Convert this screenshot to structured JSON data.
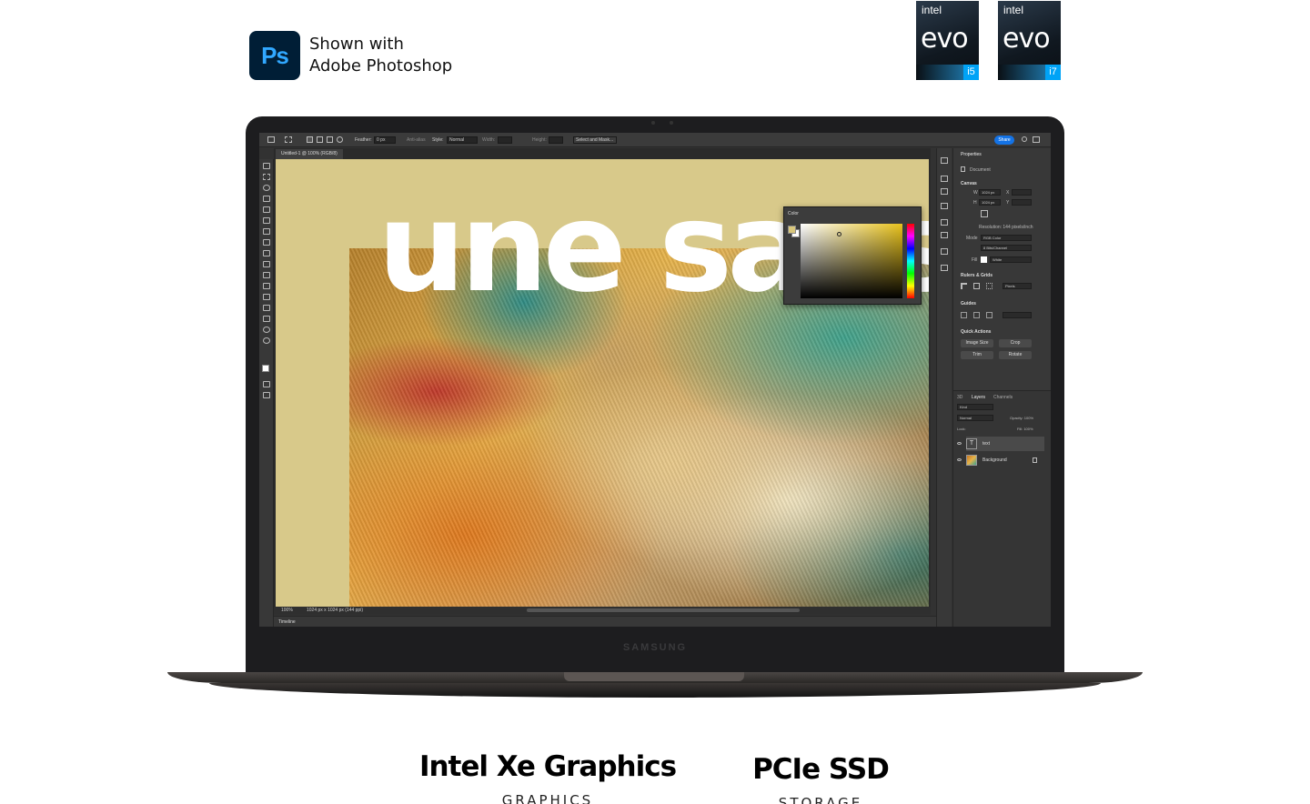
{
  "badge": {
    "ps_logo_text": "Ps",
    "line1": "Shown with",
    "line2": "Adobe Photoshop"
  },
  "evo_badges": [
    {
      "brand": "intel",
      "word": "evo",
      "gen": "i5"
    },
    {
      "brand": "intel",
      "word": "evo",
      "gen": "i7"
    }
  ],
  "laptop": {
    "bezel_brand": "SAMSUNG"
  },
  "photoshop": {
    "options": {
      "feather_label": "Feather:",
      "feather_value": "0 px",
      "antialias": "Anti-alias",
      "style_label": "Style:",
      "style_value": "Normal",
      "width_label": "Width:",
      "height_label": "Height:",
      "select_mask": "Select and Mask..."
    },
    "share": "Share",
    "document_tab": "Untitled-1 @ 100% (RGB/8)",
    "canvas_text": "une sans",
    "color_panel_title": "Color",
    "status_zoom": "100%",
    "status_size": "1024 px x 1024 px (144 ppi)",
    "timeline": "Timeline",
    "properties": {
      "title": "Properties",
      "document": "Document",
      "canvas": "Canvas",
      "w_label": "W",
      "w_value": "1024 px",
      "x_label": "X",
      "h_label": "H",
      "h_value": "1024 px",
      "y_label": "Y",
      "resolution": "Resolution: 144 pixels/inch",
      "mode_label": "Mode",
      "mode_value": "RGB Color",
      "depth_value": "8 Bits/Channel",
      "fill_label": "Fill",
      "fill_value": "White",
      "rulers": "Rulers & Grids",
      "units": "Pixels",
      "guides": "Guides",
      "quick_actions": "Quick Actions",
      "btn_image_size": "Image Size",
      "btn_crop": "Crop",
      "btn_trim": "Trim",
      "btn_rotate": "Rotate"
    },
    "layers_panel": {
      "tab_3d": "3D",
      "tab_layers": "Layers",
      "tab_channels": "Channels",
      "kind": "Kind",
      "blend": "Normal",
      "opacity": "Opacity: 100%",
      "lock": "Lock:",
      "fill": "Fill: 100%",
      "layers": [
        {
          "name": "text",
          "thumb": "T"
        },
        {
          "name": "Background",
          "thumb": ""
        }
      ]
    }
  },
  "specs": [
    {
      "title": "Intel Xe Graphics",
      "sub": "GRAPHICS"
    },
    {
      "title": "PCIe SSD",
      "sub": "STORAGE"
    }
  ]
}
